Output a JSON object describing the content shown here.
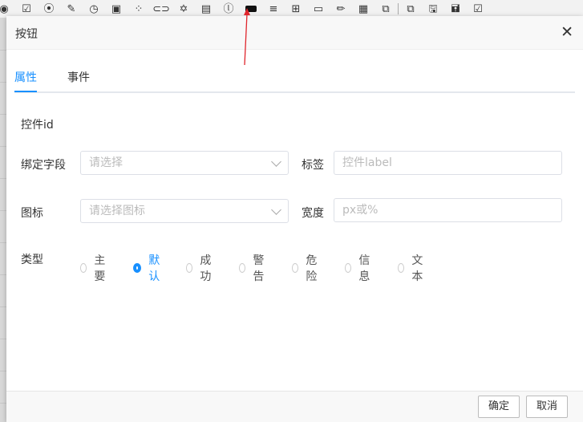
{
  "toolbar": {
    "icons": [
      {
        "name": "radio-icon",
        "glyph": "◉"
      },
      {
        "name": "checkbox-icon",
        "glyph": "☑"
      },
      {
        "name": "toggle-icon",
        "glyph": "⦿"
      },
      {
        "name": "rich-text-icon",
        "glyph": "✎"
      },
      {
        "name": "clock-icon",
        "glyph": "◷"
      },
      {
        "name": "form-icon",
        "glyph": "▣"
      },
      {
        "name": "grid-dots-icon",
        "glyph": "⁘"
      },
      {
        "name": "link-icon",
        "glyph": "⊂⊃"
      },
      {
        "name": "star-icon",
        "glyph": "✡"
      },
      {
        "name": "document-icon",
        "glyph": "▤"
      },
      {
        "name": "label-icon",
        "glyph": "ⓛ"
      },
      {
        "name": "button-icon",
        "glyph": ""
      },
      {
        "name": "text-format-icon",
        "glyph": "≡"
      },
      {
        "name": "table-icon",
        "glyph": "⊞"
      },
      {
        "name": "window-icon",
        "glyph": "▭"
      },
      {
        "name": "pencil-icon",
        "glyph": "✏"
      },
      {
        "name": "data-table-icon",
        "glyph": "▦"
      },
      {
        "name": "code-file-icon",
        "glyph": "⧉"
      },
      {
        "name": "preview-icon",
        "glyph": "⧉"
      },
      {
        "name": "save-icon",
        "glyph": "🖫"
      },
      {
        "name": "save-as-icon",
        "glyph": "🖬"
      },
      {
        "name": "check-icon",
        "glyph": "☑"
      }
    ]
  },
  "dialog": {
    "title": "按钮",
    "close": "✕",
    "tabs": [
      "属性",
      "事件"
    ],
    "control_id_label": "控件id",
    "bind_field_label": "绑定字段",
    "bind_field_placeholder": "请选择",
    "tag_label": "标签",
    "tag_placeholder": "控件label",
    "icon_label": "图标",
    "icon_placeholder": "请选择图标",
    "width_label": "宽度",
    "width_placeholder": "px或%",
    "type_label": "类型",
    "type_options": [
      "主要",
      "默认",
      "成功",
      "警告",
      "危险",
      "信息",
      "文本"
    ],
    "type_selected": "默认",
    "confirm": "确定",
    "cancel": "取消"
  },
  "colors": {
    "accent": "#1890ff",
    "annotation": "#e0262d"
  }
}
